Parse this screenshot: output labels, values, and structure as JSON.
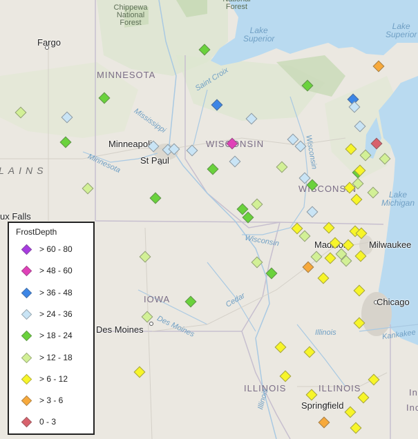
{
  "map": {
    "legend": {
      "title": "FrostDepth",
      "items": [
        {
          "label": "> 60 - 80",
          "color": "#a83be0"
        },
        {
          "label": "> 48 - 60",
          "color": "#e040b8"
        },
        {
          "label": "> 36 - 48",
          "color": "#3c86e6"
        },
        {
          "label": "> 24 - 36",
          "color": "#c9e4f5"
        },
        {
          "label": "> 18 - 24",
          "color": "#6ad23c"
        },
        {
          "label": "> 12 - 18",
          "color": "#d2f096"
        },
        {
          "label": "> 6 - 12",
          "color": "#f7f529"
        },
        {
          "label": "> 3 - 6",
          "color": "#f7a93b"
        },
        {
          "label": "0 - 3",
          "color": "#d8616c"
        }
      ]
    },
    "labels": {
      "chippewa": "Chippewa\nNational\nForest",
      "nationalforest": "National\nForest",
      "lake_superior": "Lake\nSuperior",
      "lake_superior_2": "Lake\nSuperior",
      "fargo": "Fargo",
      "minnesota": "MINNESOTA",
      "wisconsin": "WISCONSIN",
      "wisconsin_2": "WISCONSIN",
      "iowa": "IOWA",
      "illinois": "ILLINOIS",
      "illinois_2": "ILLINOIS",
      "minneapolis": "Minneapolis",
      "stpaul": "St Paul",
      "saint_croix": "Saint Croix",
      "mississippi": "Mississippi",
      "minnesota_river": "Minnesota",
      "wisconsin_river": "Wisconsin",
      "wisconsin_river_2": "Wisconsin",
      "plains": "LAINS",
      "sioux_falls": "ux Falls",
      "madison": "Madison",
      "milwaukee": "Milwaukee",
      "lake_michigan": "Lake\nMichigan",
      "chicago": "Chicago",
      "des_moines": "Des Moines",
      "des_moines_river": "Des Moines",
      "cedar": "Cedar",
      "illinois_river": "Illinois",
      "illinois_river_2": "Illinois",
      "kankakee": "Kankakee",
      "springfield": "Springfield",
      "indiana_partial": "Inc",
      "indiana_partial_2": "In"
    },
    "stations": [
      {
        "cls": "18-24",
        "pos": [
          296,
          72
        ]
      },
      {
        "cls": "3-6",
        "pos": [
          548,
          96
        ]
      },
      {
        "cls": "18-24",
        "pos": [
          445,
          124
        ]
      },
      {
        "cls": "36-48",
        "pos": [
          511,
          144
        ]
      },
      {
        "cls": "18-24",
        "pos": [
          151,
          142
        ]
      },
      {
        "cls": "36-48",
        "pos": [
          314,
          152
        ]
      },
      {
        "cls": "24-36",
        "pos": [
          513,
          155
        ]
      },
      {
        "cls": "12-18",
        "pos": [
          30,
          163
        ]
      },
      {
        "cls": "24-36",
        "pos": [
          97,
          170
        ]
      },
      {
        "cls": "24-36",
        "pos": [
          364,
          172
        ]
      },
      {
        "cls": "24-36",
        "pos": [
          521,
          183
        ]
      },
      {
        "cls": "18-24",
        "pos": [
          95,
          206
        ]
      },
      {
        "cls": "48-60",
        "pos": [
          336,
          208
        ]
      },
      {
        "cls": "24-36",
        "pos": [
          424,
          202
        ]
      },
      {
        "cls": "24-36",
        "pos": [
          435,
          212
        ]
      },
      {
        "cls": "24-36",
        "pos": [
          222,
          212
        ]
      },
      {
        "cls": "24-36",
        "pos": [
          243,
          217
        ]
      },
      {
        "cls": "24-36",
        "pos": [
          252,
          216
        ]
      },
      {
        "cls": "24-36",
        "pos": [
          278,
          218
        ]
      },
      {
        "cls": "6-12",
        "pos": [
          508,
          216
        ]
      },
      {
        "cls": "0-3",
        "pos": [
          545,
          208
        ]
      },
      {
        "cls": "12-18",
        "pos": [
          529,
          225
        ]
      },
      {
        "cls": "12-18",
        "pos": [
          557,
          230
        ]
      },
      {
        "cls": "24-36",
        "pos": [
          340,
          234
        ]
      },
      {
        "cls": "18-24",
        "pos": [
          308,
          245
        ]
      },
      {
        "cls": "12-18",
        "pos": [
          408,
          242
        ]
      },
      {
        "cls": "18-24",
        "pos": [
          518,
          250
        ]
      },
      {
        "cls": "6-12",
        "pos": [
          521,
          247
        ]
      },
      {
        "cls": "24-36",
        "pos": [
          441,
          258
        ]
      },
      {
        "cls": "18-24",
        "pos": [
          452,
          268
        ]
      },
      {
        "cls": "12-18",
        "pos": [
          518,
          266
        ]
      },
      {
        "cls": "6-12",
        "pos": [
          506,
          272
        ]
      },
      {
        "cls": "12-18",
        "pos": [
          127,
          273
        ]
      },
      {
        "cls": "12-18",
        "pos": [
          540,
          279
        ]
      },
      {
        "cls": "6-12",
        "pos": [
          516,
          289
        ]
      },
      {
        "cls": "18-24",
        "pos": [
          225,
          287
        ]
      },
      {
        "cls": "12-18",
        "pos": [
          372,
          296
        ]
      },
      {
        "cls": "18-24",
        "pos": [
          351,
          303
        ]
      },
      {
        "cls": "24-36",
        "pos": [
          452,
          307
        ]
      },
      {
        "cls": "18-24",
        "pos": [
          359,
          315
        ]
      },
      {
        "cls": "6-12",
        "pos": [
          430,
          331
        ]
      },
      {
        "cls": "6-12",
        "pos": [
          476,
          330
        ]
      },
      {
        "cls": "6-12",
        "pos": [
          514,
          335
        ]
      },
      {
        "cls": "6-12",
        "pos": [
          523,
          338
        ]
      },
      {
        "cls": "12-18",
        "pos": [
          441,
          342
        ]
      },
      {
        "cls": "6-12",
        "pos": [
          485,
          352
        ]
      },
      {
        "cls": "6-12",
        "pos": [
          504,
          355
        ]
      },
      {
        "cls": "12-18",
        "pos": [
          458,
          372
        ]
      },
      {
        "cls": "6-12",
        "pos": [
          478,
          374
        ]
      },
      {
        "cls": "12-18",
        "pos": [
          494,
          368
        ]
      },
      {
        "cls": "12-18",
        "pos": [
          501,
          378
        ]
      },
      {
        "cls": "6-12",
        "pos": [
          522,
          371
        ]
      },
      {
        "cls": "12-18",
        "pos": [
          210,
          372
        ]
      },
      {
        "cls": "12-18",
        "pos": [
          372,
          380
        ]
      },
      {
        "cls": "3-6",
        "pos": [
          446,
          387
        ]
      },
      {
        "cls": "18-24",
        "pos": [
          393,
          396
        ]
      },
      {
        "cls": "6-12",
        "pos": [
          468,
          403
        ]
      },
      {
        "cls": "6-12",
        "pos": [
          520,
          421
        ]
      },
      {
        "cls": "18-24",
        "pos": [
          276,
          437
        ]
      },
      {
        "cls": "12-18",
        "pos": [
          213,
          459
        ]
      },
      {
        "cls": "6-12",
        "pos": [
          520,
          468
        ]
      },
      {
        "cls": "6-12",
        "pos": [
          406,
          503
        ]
      },
      {
        "cls": "6-12",
        "pos": [
          448,
          510
        ]
      },
      {
        "cls": "6-12",
        "pos": [
          202,
          539
        ]
      },
      {
        "cls": "6-12",
        "pos": [
          413,
          545
        ]
      },
      {
        "cls": "6-12",
        "pos": [
          541,
          550
        ]
      },
      {
        "cls": "6-12",
        "pos": [
          451,
          572
        ]
      },
      {
        "cls": "6-12",
        "pos": [
          526,
          576
        ]
      },
      {
        "cls": "6-12",
        "pos": [
          507,
          597
        ]
      },
      {
        "cls": "3-6",
        "pos": [
          469,
          612
        ]
      },
      {
        "cls": "6-12",
        "pos": [
          515,
          620
        ]
      }
    ]
  }
}
